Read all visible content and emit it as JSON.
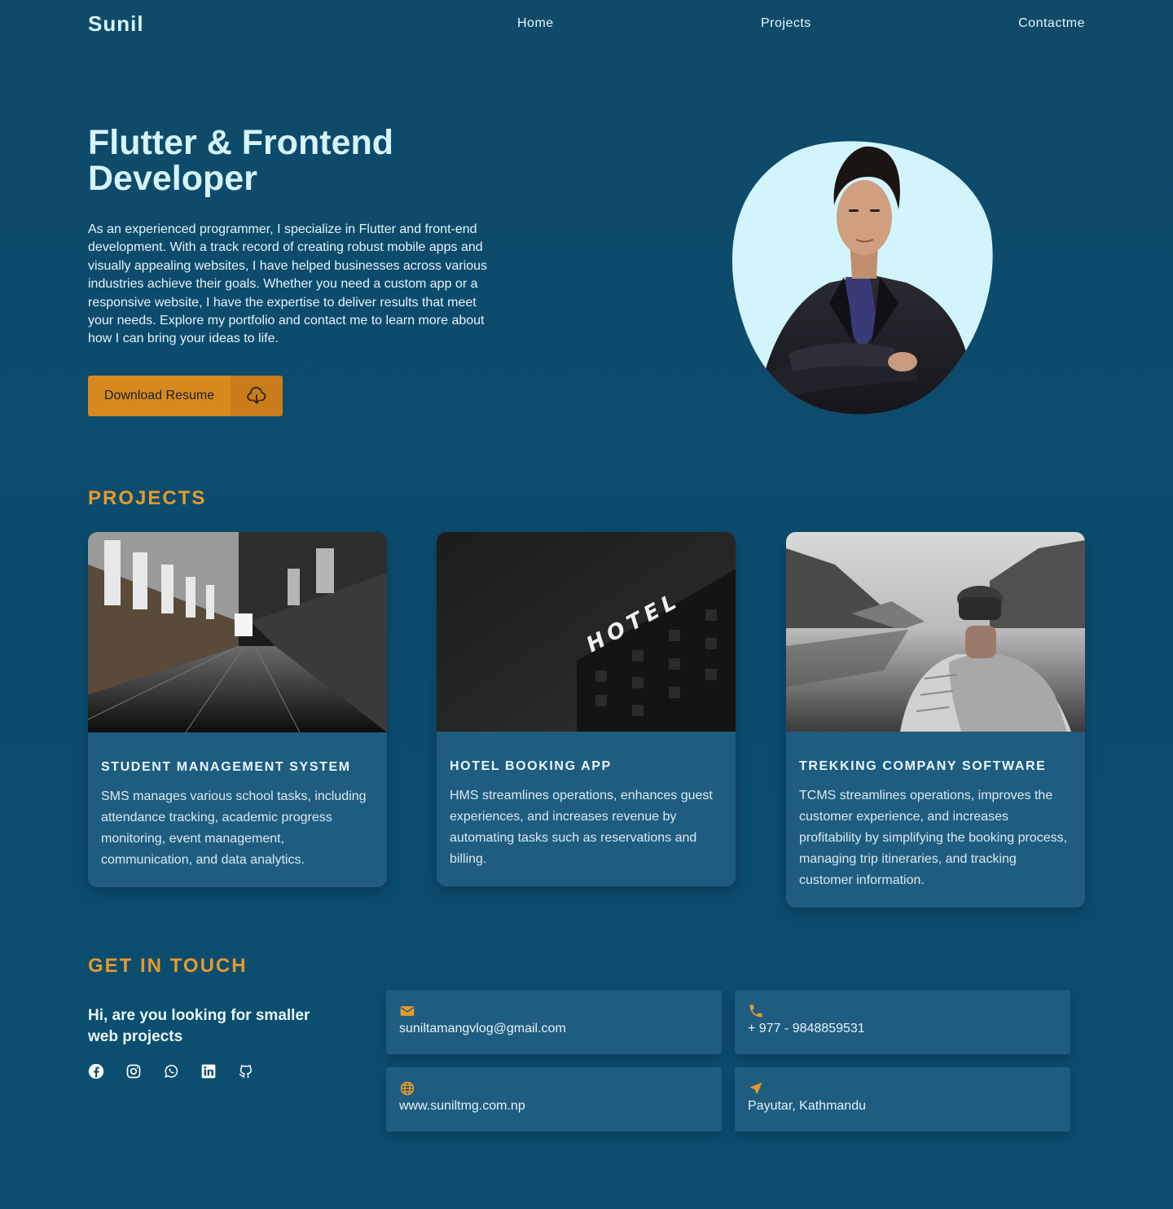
{
  "nav": {
    "logo": "Sunil",
    "links": [
      "Home",
      "Projects",
      "Contactme"
    ]
  },
  "hero": {
    "title": "Flutter & Frontend Developer",
    "description": "As an experienced programmer, I specialize in Flutter and front-end development. With a track record of creating robust mobile apps and visually appealing websites, I have helped businesses across various industries achieve their goals. Whether you need a custom app or a responsive website, I have the expertise to deliver results that meet your needs. Explore my portfolio and contact me to learn more about how I can bring your ideas to life.",
    "resume_label": "Download Resume"
  },
  "projects": {
    "heading": "PROJECTS",
    "items": [
      {
        "title": "STUDENT MANAGEMENT SYSTEM",
        "description": "SMS manages various school tasks, including attendance tracking, academic progress monitoring, event management, communication, and data analytics."
      },
      {
        "title": "HOTEL BOOKING APP",
        "description": "HMS streamlines operations, enhances guest experiences, and increases revenue by automating tasks such as reservations and billing.",
        "image_sign": "HOTEL"
      },
      {
        "title": "TREKKING COMPANY SOFTWARE",
        "description": "TCMS streamlines operations, improves the customer experience, and increases profitability by simplifying the booking process, managing trip itineraries, and tracking customer information."
      }
    ]
  },
  "contact": {
    "heading": "GET IN TOUCH",
    "lead": "Hi, are you looking for smaller web projects",
    "socials": [
      "facebook-icon",
      "instagram-icon",
      "whatsapp-icon",
      "linkedin-icon",
      "github-icon"
    ],
    "email": "suniltamangvlog@gmail.com",
    "phone": "+ 977 - 9848859531",
    "website": "www.suniltmg.com.np",
    "location": "Payutar, Kathmandu"
  },
  "colors": {
    "background": "#0b4c6e",
    "accent": "#e79a2c",
    "card": "#1f5d80",
    "avatar_blob": "#d2f5fd"
  }
}
